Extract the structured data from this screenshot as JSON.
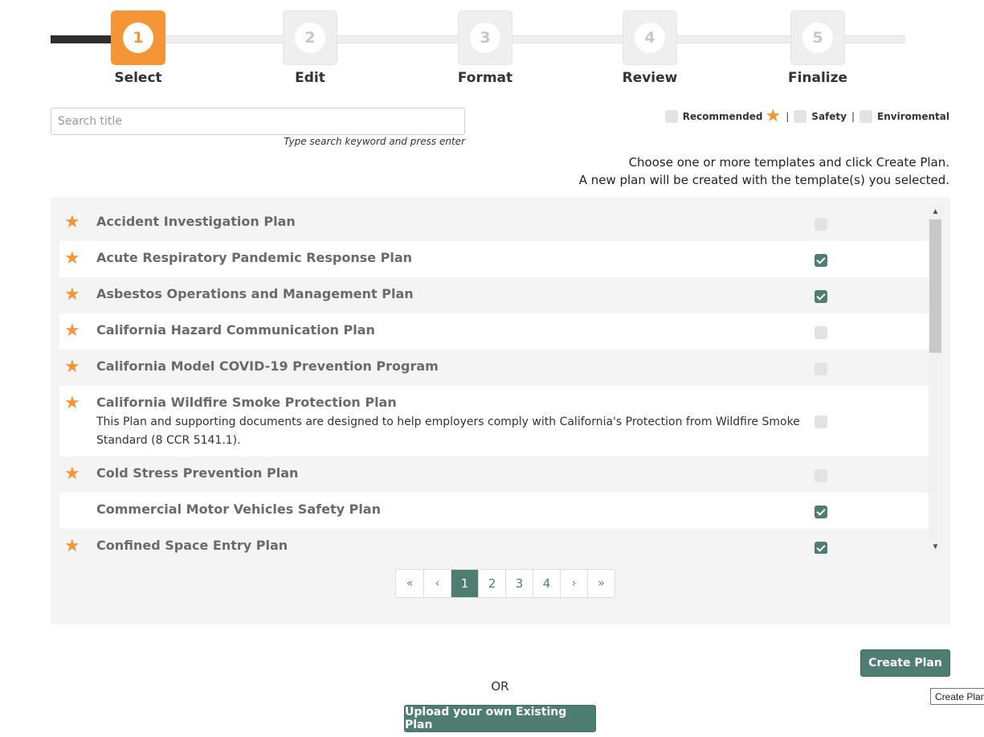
{
  "stepper": {
    "steps": [
      {
        "number": "1",
        "label": "Select",
        "active": true
      },
      {
        "number": "2",
        "label": "Edit",
        "active": false
      },
      {
        "number": "3",
        "label": "Format",
        "active": false
      },
      {
        "number": "4",
        "label": "Review",
        "active": false
      },
      {
        "number": "5",
        "label": "Finalize",
        "active": false
      }
    ]
  },
  "search": {
    "placeholder": "Search title",
    "value": "",
    "hint": "Type search keyword and press enter"
  },
  "legend": {
    "recommended": "Recommended",
    "safety": "Safety",
    "environmental": "Enviromental",
    "separator": "|"
  },
  "instructions": {
    "line1": "Choose one or more templates and click Create Plan.",
    "line2": "A new plan will be created with the template(s) you selected."
  },
  "templates": [
    {
      "title": "Accident Investigation Plan",
      "recommended": true,
      "checked": false,
      "description": ""
    },
    {
      "title": "Acute Respiratory Pandemic Response Plan",
      "recommended": true,
      "checked": true,
      "description": ""
    },
    {
      "title": "Asbestos Operations and Management Plan",
      "recommended": true,
      "checked": true,
      "description": ""
    },
    {
      "title": "California Hazard Communication Plan",
      "recommended": true,
      "checked": false,
      "description": ""
    },
    {
      "title": "California Model COVID-19 Prevention Program",
      "recommended": true,
      "checked": false,
      "description": ""
    },
    {
      "title": "California Wildfire Smoke Protection Plan",
      "recommended": true,
      "checked": false,
      "description": "This Plan and supporting documents are designed to help employers comply with California's Protection from Wildfire Smoke Standard (8 CCR 5141.1)."
    },
    {
      "title": "Cold Stress Prevention Plan",
      "recommended": true,
      "checked": false,
      "description": ""
    },
    {
      "title": "Commercial Motor Vehicles Safety Plan",
      "recommended": false,
      "checked": true,
      "description": ""
    },
    {
      "title": "Confined Space Entry Plan",
      "recommended": true,
      "checked": true,
      "description": ""
    }
  ],
  "icons": {
    "star": "★",
    "scroll_up": "▲",
    "scroll_down": "▼"
  },
  "pagination": {
    "first": "«",
    "prev": "‹",
    "pages": [
      "1",
      "2",
      "3",
      "4"
    ],
    "current": "1",
    "next": "›",
    "last": "»"
  },
  "actions": {
    "create_plan": "Create Plan",
    "or": "OR",
    "upload": "Upload your own Existing Plan",
    "tooltip": "Create Plan"
  },
  "colors": {
    "accent_orange": "#f59536",
    "primary_green": "#4e7d72",
    "progress_dark": "#2e2e2e"
  }
}
